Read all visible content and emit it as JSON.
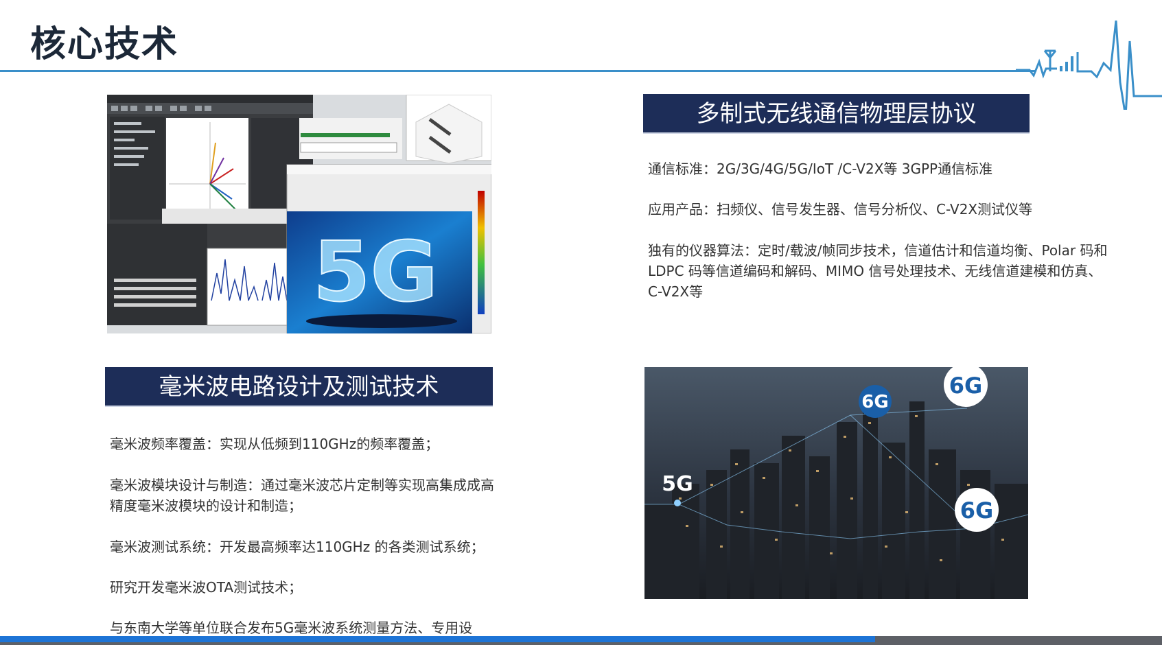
{
  "header": {
    "title": "核心技术"
  },
  "sections": {
    "protocol": {
      "heading": "多制式无线通信物理层协议",
      "lines": [
        "通信标准：2G/3G/4G/5G/IoT /C-V2X等 3GPP通信标准",
        "应用产品：扫频仪、信号发生器、信号分析仪、C-V2X测试仪等",
        "独有的仪器算法：定时/载波/帧同步技术，信道估计和信道均衡、Polar 码和",
        "LDPC 码等信道编码和解码、MIMO 信号处理技术、无线信道建模和仿真、",
        "C-V2X等"
      ]
    },
    "mmwave": {
      "heading": "毫米波电路设计及测试技术",
      "lines": [
        "毫米波频率覆盖：实现从低频到110GHz的频率覆盖；",
        "毫米波模块设计与制造：通过毫米波芯片定制等实现高集成成高",
        "精度毫米波模块的设计和制造；",
        "毫米波测试系统：开发最高频率达110GHz 的各类测试系统；",
        "研究开发毫米波OTA测试技术；",
        "与东南大学等单位联合发布5G毫米波系统测量方法、专用设"
      ]
    }
  },
  "images": {
    "software_collage": {
      "big_label": "5G",
      "icon": "software-screenshot-collage"
    },
    "city": {
      "labels": [
        "6G",
        "6G",
        "5G",
        "6G"
      ],
      "icon": "city-night-network-photo"
    }
  },
  "progress": {
    "value_percent": 75.3
  },
  "colors": {
    "banner": "#1d2d58",
    "line": "#3a8fc9",
    "progress": "#1d74d6"
  }
}
